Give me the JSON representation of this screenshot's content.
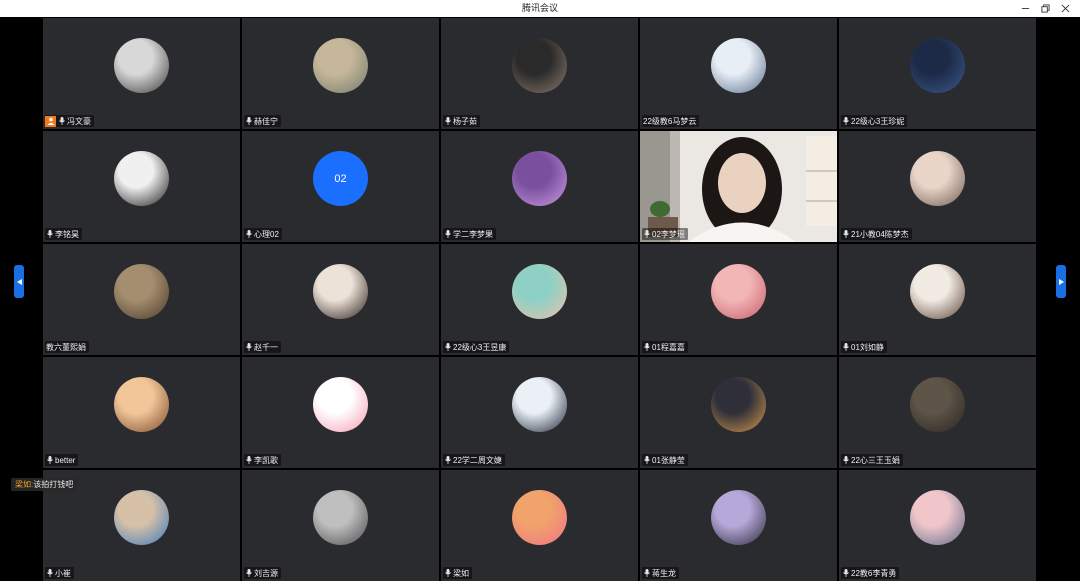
{
  "window": {
    "title": "腾讯会议"
  },
  "chat_popup": {
    "sender": "梁如:",
    "message": "该拍打钱吧"
  },
  "participants": [
    {
      "name": "冯文豪",
      "host": true,
      "avatar": "panda-avatar",
      "colors": [
        "#d8d8d8",
        "#3a3a3a"
      ]
    },
    {
      "name": "赫佳宁",
      "avatar": "photo-avatar",
      "colors": [
        "#c7b79a",
        "#6f7b6a"
      ]
    },
    {
      "name": "杨子茹",
      "avatar": "portrait-avatar",
      "colors": [
        "#2a2a2a",
        "#8c7a6e"
      ]
    },
    {
      "name": "22级教6马梦云",
      "no_mic": true,
      "avatar": "anime-avatar",
      "colors": [
        "#e7eef6",
        "#58708a"
      ]
    },
    {
      "name": "22级心3王珍妮",
      "avatar": "dark-blue-avatar",
      "colors": [
        "#1c2a48",
        "#3e5a8a"
      ]
    },
    {
      "name": "李铭昊",
      "avatar": "sketch-avatar",
      "colors": [
        "#f0f0f0",
        "#1a1a1a"
      ]
    },
    {
      "name": "心理02",
      "avatar_text": "02",
      "colors": [
        "#1a6fff",
        "#1a6fff"
      ]
    },
    {
      "name": "学二李梦果",
      "avatar": "purple-avatar",
      "colors": [
        "#7a4f9e",
        "#c89be0"
      ]
    },
    {
      "name": "02李梦瑶",
      "video": true
    },
    {
      "name": "21小教04陈梦杰",
      "avatar": "girl-avatar",
      "colors": [
        "#e9d6c9",
        "#6f5a52"
      ]
    },
    {
      "name": "教六董熙娟",
      "no_mic": true,
      "avatar": "vintage-avatar",
      "colors": [
        "#a58e6f",
        "#4a3a2a"
      ]
    },
    {
      "name": "赵千一",
      "avatar": "woman-photo-avatar",
      "colors": [
        "#ece2d8",
        "#2a1e1a"
      ]
    },
    {
      "name": "22级心3王昱康",
      "avatar": "anime-teal-avatar",
      "colors": [
        "#8fd0c6",
        "#e8c2a8"
      ]
    },
    {
      "name": "01程嘉嘉",
      "avatar": "pink-anime-avatar",
      "colors": [
        "#f3b6b6",
        "#c65d6a"
      ]
    },
    {
      "name": "01刘如静",
      "avatar": "cartoon-girl-avatar",
      "colors": [
        "#f2ebe4",
        "#5a4234"
      ]
    },
    {
      "name": "better",
      "avatar": "warm-avatar",
      "colors": [
        "#f3c69a",
        "#7a4a2a"
      ]
    },
    {
      "name": "李凯歌",
      "avatar": "pink-bear-avatar",
      "colors": [
        "#ffffff",
        "#f59ab1"
      ]
    },
    {
      "name": "22学二周文婕",
      "avatar": "anime-dark-avatar",
      "colors": [
        "#eaf0f6",
        "#1e2434"
      ]
    },
    {
      "name": "01张静莹",
      "avatar": "sunset-avatar",
      "colors": [
        "#2f2f3a",
        "#d69a4c"
      ]
    },
    {
      "name": "22心三王玉娟",
      "avatar": "cat-avatar",
      "colors": [
        "#5e5448",
        "#2a2622"
      ]
    },
    {
      "name": "小崔",
      "avatar": "glasses-avatar",
      "colors": [
        "#d6c0a8",
        "#3a7bc0"
      ]
    },
    {
      "name": "刘吉源",
      "avatar": "grayscale-avatar",
      "colors": [
        "#bfbfbf",
        "#4a4a4a"
      ]
    },
    {
      "name": "梁如",
      "avatar": "orange-art-avatar",
      "colors": [
        "#f0a36a",
        "#f0708a"
      ]
    },
    {
      "name": "蒋生龙",
      "avatar": "pastel-avatar",
      "colors": [
        "#b6a8d8",
        "#2a2a3a"
      ]
    },
    {
      "name": "22教6李青勇",
      "avatar": "couple-cartoon-avatar",
      "colors": [
        "#f0c6ca",
        "#5a6a8a"
      ]
    }
  ]
}
